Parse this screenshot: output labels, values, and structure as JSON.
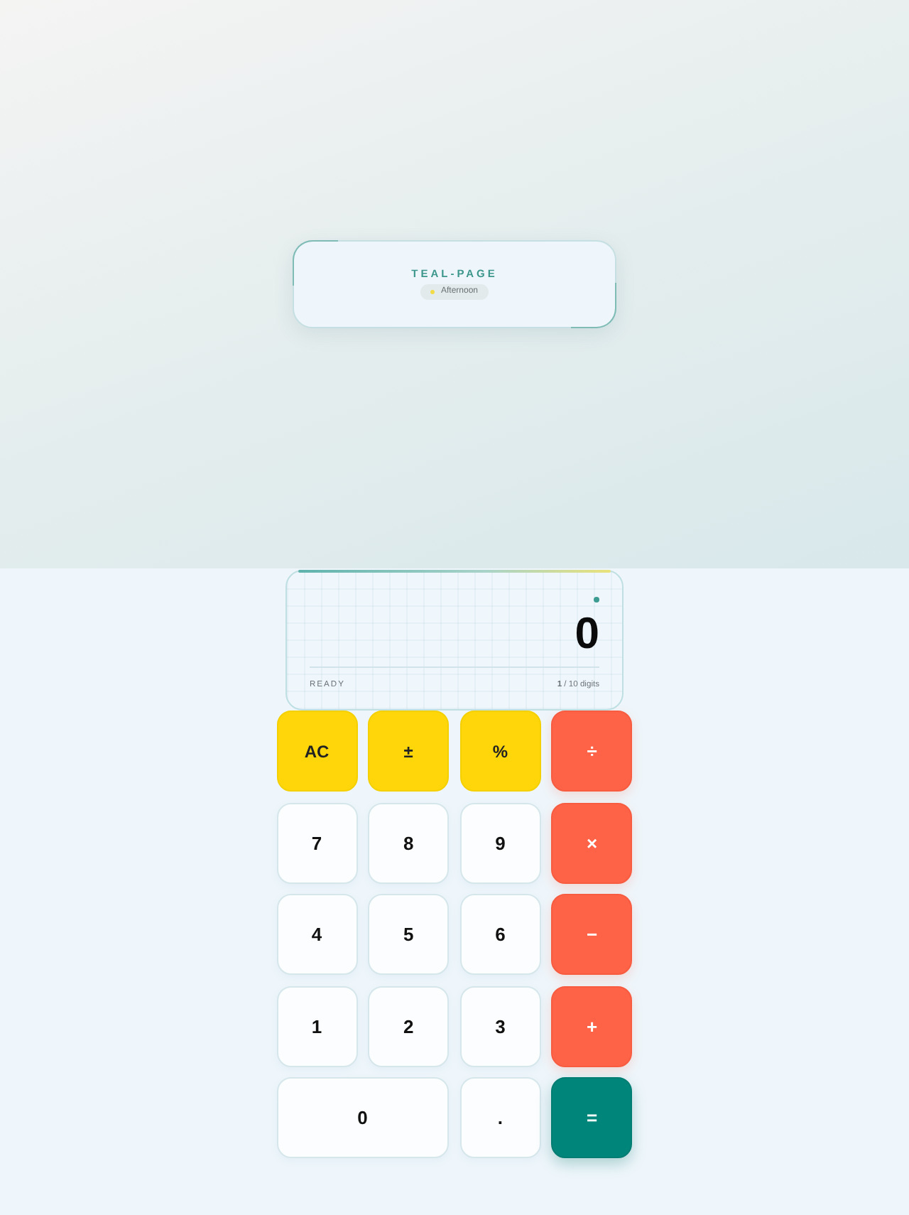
{
  "header_card": {
    "title": "TEAL-PAGE",
    "badge": {
      "label": "Afternoon"
    }
  },
  "display": {
    "value": "0",
    "status": "READY",
    "digit_counter": "**1** / 10 digits"
  },
  "keys": [
    {
      "label": "AC",
      "kind": "function"
    },
    {
      "label": "±",
      "kind": "function"
    },
    {
      "label": "%",
      "kind": "function"
    },
    {
      "label": "÷",
      "kind": "operator"
    },
    {
      "label": "7",
      "kind": "digit"
    },
    {
      "label": "8",
      "kind": "digit"
    },
    {
      "label": "9",
      "kind": "digit"
    },
    {
      "label": "×",
      "kind": "operator"
    },
    {
      "label": "4",
      "kind": "digit"
    },
    {
      "label": "5",
      "kind": "digit"
    },
    {
      "label": "6",
      "kind": "digit"
    },
    {
      "label": "−",
      "kind": "operator"
    },
    {
      "label": "1",
      "kind": "digit"
    },
    {
      "label": "2",
      "kind": "digit"
    },
    {
      "label": "3",
      "kind": "digit"
    },
    {
      "label": "+",
      "kind": "operator"
    },
    {
      "label": "0",
      "kind": "wide"
    },
    {
      "label": ".",
      "kind": "digit"
    },
    {
      "label": "=",
      "kind": "equals"
    }
  ]
}
